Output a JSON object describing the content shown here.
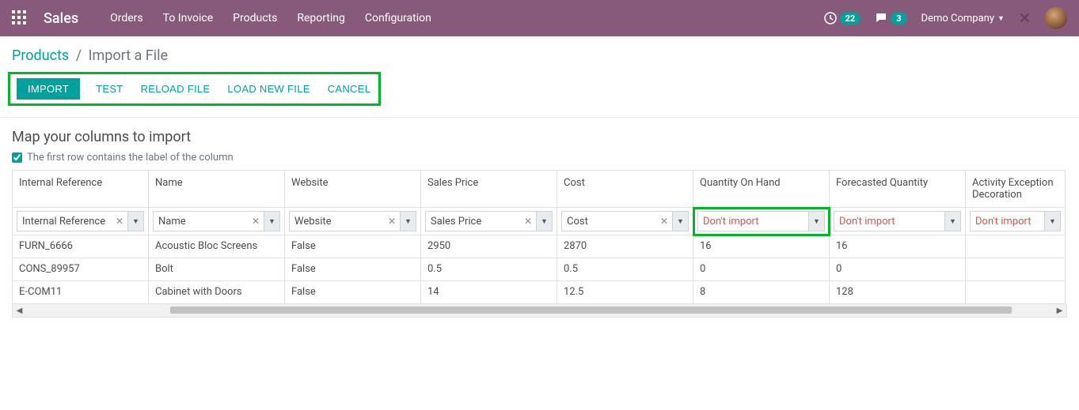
{
  "navbar": {
    "brand": "Sales",
    "links": [
      "Orders",
      "To Invoice",
      "Products",
      "Reporting",
      "Configuration"
    ],
    "activity_badge": "22",
    "discuss_badge": "3",
    "company": "Demo Company"
  },
  "breadcrumb": {
    "root": "Products",
    "current": "Import a File"
  },
  "toolbar": {
    "import": "IMPORT",
    "test": "TEST",
    "reload": "RELOAD FILE",
    "loadnew": "LOAD NEW FILE",
    "cancel": "CANCEL"
  },
  "section": {
    "title": "Map your columns to import",
    "first_row_label": "The first row contains the label of the column"
  },
  "columns": [
    {
      "header": "Internal Reference",
      "map": "Internal Reference",
      "clearable": true,
      "dont": false,
      "highlight": false
    },
    {
      "header": "Name",
      "map": "Name",
      "clearable": true,
      "dont": false,
      "highlight": false
    },
    {
      "header": "Website",
      "map": "Website",
      "clearable": true,
      "dont": false,
      "highlight": false
    },
    {
      "header": "Sales Price",
      "map": "Sales Price",
      "clearable": true,
      "dont": false,
      "highlight": false
    },
    {
      "header": "Cost",
      "map": "Cost",
      "clearable": true,
      "dont": false,
      "highlight": false
    },
    {
      "header": "Quantity On Hand",
      "map": "Don't import",
      "clearable": false,
      "dont": true,
      "highlight": true
    },
    {
      "header": "Forecasted Quantity",
      "map": "Don't import",
      "clearable": false,
      "dont": true,
      "highlight": false
    },
    {
      "header": "Activity Exception Decoration",
      "map": "Don't import",
      "clearable": false,
      "dont": true,
      "highlight": false
    }
  ],
  "rows": [
    [
      "FURN_6666",
      "Acoustic Bloc Screens",
      "False",
      "2950",
      "2870",
      "16",
      "16",
      ""
    ],
    [
      "CONS_89957",
      "Bolt",
      "False",
      "0.5",
      "0.5",
      "0",
      "0",
      ""
    ],
    [
      "E-COM11",
      "Cabinet with Doors",
      "False",
      "14",
      "12.5",
      "8",
      "128",
      ""
    ]
  ]
}
